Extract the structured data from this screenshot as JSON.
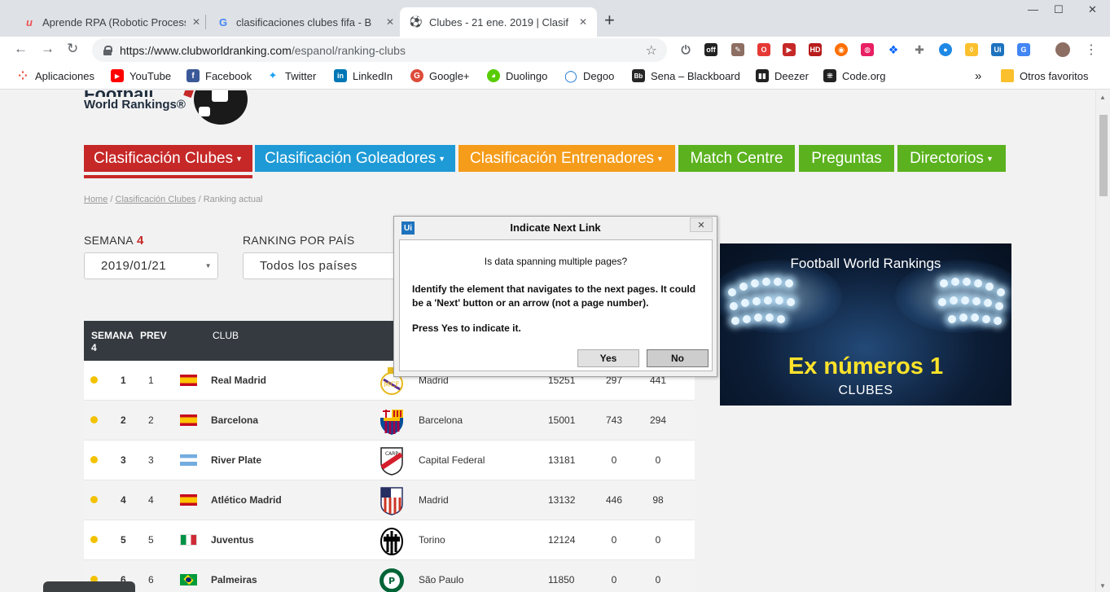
{
  "browser": {
    "tabs": [
      {
        "title": "Aprende RPA (Robotic Process",
        "icon": "udemy-icon",
        "color": "#ec5252",
        "glyph": "u"
      },
      {
        "title": "clasificaciones clubes fifa - B",
        "icon": "google-icon",
        "color": "#4285f4",
        "glyph": "G"
      },
      {
        "title": "Clubes - 21 ene. 2019 | Clasif",
        "icon": "football-icon",
        "color": "#222222",
        "glyph": "⚽"
      }
    ],
    "tab_close": "✕",
    "new_tab": "+",
    "win_min": "—",
    "win_max": "☐",
    "win_close": "✕",
    "url_main": "https://www.clubworldranking.com",
    "url_rest": "/espanol/ranking-clubs",
    "bookmarks": [
      {
        "label": "Aplicaciones",
        "icon": "apps-grid-icon",
        "color": "#ea4335",
        "glyph": "⋮"
      },
      {
        "label": "YouTube",
        "icon": "youtube-icon",
        "color": "#ff0000",
        "glyph": "▶"
      },
      {
        "label": "Facebook",
        "icon": "facebook-icon",
        "color": "#3b5998",
        "glyph": "f"
      },
      {
        "label": "Twitter",
        "icon": "twitter-icon",
        "color": "#1da1f2",
        "glyph": "t"
      },
      {
        "label": "LinkedIn",
        "icon": "linkedin-icon",
        "color": "#0077b5",
        "glyph": "in"
      },
      {
        "label": "Google+",
        "icon": "google-plus-icon",
        "color": "#dd4b39",
        "glyph": "G"
      },
      {
        "label": "Duolingo",
        "icon": "duolingo-icon",
        "color": "#58cc02",
        "glyph": "D"
      },
      {
        "label": "Degoo",
        "icon": "degoo-icon",
        "color": "#1976d2",
        "glyph": "O"
      },
      {
        "label": "Sena – Blackboard",
        "icon": "blackboard-icon",
        "color": "#262626",
        "glyph": "Bb"
      },
      {
        "label": "Deezer",
        "icon": "deezer-icon",
        "color": "#222222",
        "glyph": "≡"
      },
      {
        "label": "Code.org",
        "icon": "codeorg-icon",
        "color": "#00adbc",
        "glyph": "#"
      }
    ],
    "bookmarks_more": "»",
    "other_favorites": "Otros favoritos"
  },
  "site": {
    "logo_line1": "Football",
    "logo_line2": "World Rankings®",
    "nav": [
      {
        "label": "Clasificación Clubes",
        "color": "#c62828",
        "caret": "▼"
      },
      {
        "label": "Clasificación Goleadores",
        "color": "#1e9ad6",
        "caret": "▼"
      },
      {
        "label": "Clasificación Entrenadores",
        "color": "#f59c1a",
        "caret": "▼"
      },
      {
        "label": "Match Centre",
        "color": "#5bb21e",
        "caret": ""
      },
      {
        "label": "Preguntas",
        "color": "#5bb21e",
        "caret": ""
      },
      {
        "label": "Directorios",
        "color": "#5bb21e",
        "caret": "▼"
      }
    ],
    "breadcrumb": {
      "home": "Home",
      "sep": " / ",
      "clubs": "Clasificación Clubes",
      "current": "Ranking actual"
    },
    "semana_label": "SEMANA",
    "semana_num": "4",
    "date_value": "2019/01/21",
    "pais_label": "RANKING POR PAÍS",
    "pais_value": "Todos los países",
    "table_head": {
      "semana": "SEMANA",
      "semana_num": "4",
      "prev": "PREV",
      "club": "CLUB"
    },
    "rows": [
      {
        "pos": "1",
        "prev": "1",
        "flag": "es",
        "club": "Real Madrid",
        "crest": "real-madrid",
        "city": "Madrid",
        "pts": "15251",
        "c1": "297",
        "c2": "441"
      },
      {
        "pos": "2",
        "prev": "2",
        "flag": "es",
        "club": "Barcelona",
        "crest": "barcelona",
        "city": "Barcelona",
        "pts": "15001",
        "c1": "743",
        "c2": "294"
      },
      {
        "pos": "3",
        "prev": "3",
        "flag": "ar",
        "club": "River Plate",
        "crest": "river-plate",
        "city": "Capital Federal",
        "pts": "13181",
        "c1": "0",
        "c2": "0"
      },
      {
        "pos": "4",
        "prev": "4",
        "flag": "es",
        "club": "Atlético Madrid",
        "crest": "atletico",
        "city": "Madrid",
        "pts": "13132",
        "c1": "446",
        "c2": "98"
      },
      {
        "pos": "5",
        "prev": "5",
        "flag": "it",
        "club": "Juventus",
        "crest": "juventus",
        "city": "Torino",
        "pts": "12124",
        "c1": "0",
        "c2": "0"
      },
      {
        "pos": "6",
        "prev": "6",
        "flag": "br",
        "club": "Palmeiras",
        "crest": "palmeiras",
        "city": "São Paulo",
        "pts": "11850",
        "c1": "0",
        "c2": "0"
      }
    ],
    "ad": {
      "title": "Football World Rankings",
      "big": "Ex números 1",
      "sub": "CLUBES"
    }
  },
  "dialog": {
    "logo": "Ui",
    "title": "Indicate Next Link",
    "close": "✕",
    "question": "Is data spanning multiple pages?",
    "message": "Identify the element that navigates to the next pages. It could be a 'Next' button or an arrow (not a page number).",
    "message2": "Press Yes to indicate it.",
    "yes": "Yes",
    "no": "No"
  }
}
